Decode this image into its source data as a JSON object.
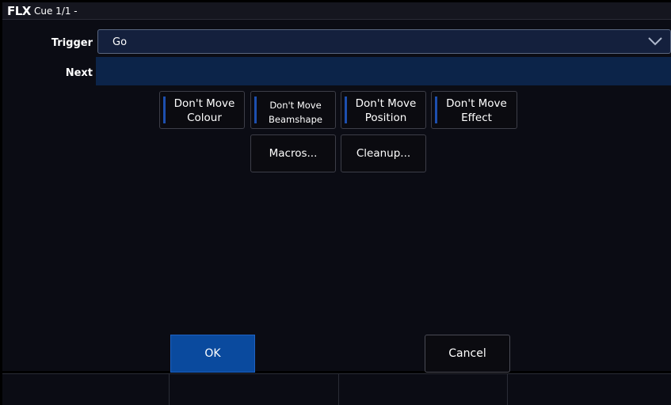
{
  "window": {
    "logo": "FLX",
    "title": "Cue 1/1 -"
  },
  "trigger": {
    "label": "Trigger",
    "value": "Go",
    "icon": "chevron-down-icon"
  },
  "next": {
    "label": "Next",
    "value": ""
  },
  "options": [
    {
      "line1": "Don't Move",
      "line2": "Colour"
    },
    {
      "line1": "Don't Move",
      "line2": "Beamshape"
    },
    {
      "line1": "Don't Move",
      "line2": "Position"
    },
    {
      "line1": "Don't Move",
      "line2": "Effect"
    }
  ],
  "actions": {
    "macros": "Macros...",
    "cleanup": "Cleanup..."
  },
  "dialog": {
    "ok": "OK",
    "cancel": "Cancel"
  },
  "colors": {
    "accent": "#0a4a9e",
    "field": "#0c2449",
    "indicator": "#1d4fae"
  }
}
